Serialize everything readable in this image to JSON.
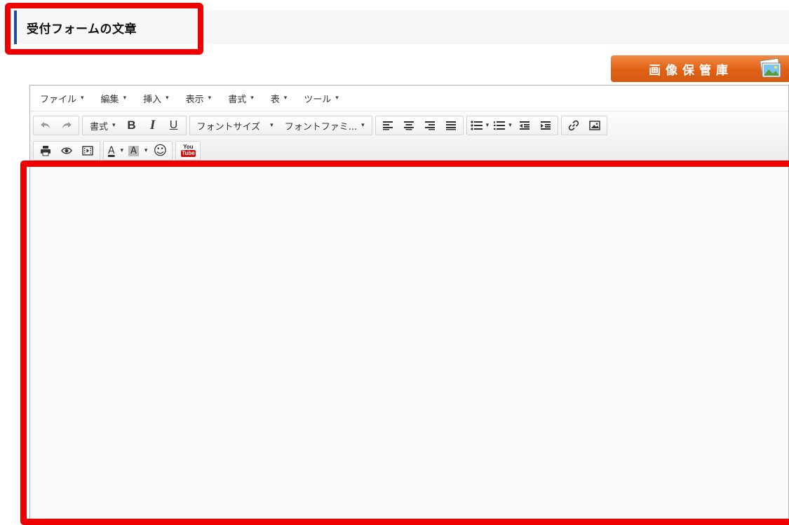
{
  "section": {
    "title": "受付フォームの文章"
  },
  "image_store": {
    "label": "画像保管庫",
    "icon": "photo-gallery-icon"
  },
  "menubar": {
    "items": [
      {
        "label": "ファイル"
      },
      {
        "label": "編集"
      },
      {
        "label": "挿入"
      },
      {
        "label": "表示"
      },
      {
        "label": "書式"
      },
      {
        "label": "表"
      },
      {
        "label": "ツール"
      }
    ],
    "caret": "▾"
  },
  "toolbar": {
    "format_label": "書式",
    "bold": "B",
    "italic": "I",
    "underline": "U",
    "font_size_label": "フォントサイズ",
    "font_family_label": "フォントファミ...",
    "text_color_label": "A",
    "bg_color_label": "A",
    "emoticon": "☺",
    "youtube_you": "You",
    "youtube_tube": "Tube"
  },
  "highlight_color": "#ee0000",
  "accent_orange": "#e06015",
  "title_accent": "#1f4fa3"
}
